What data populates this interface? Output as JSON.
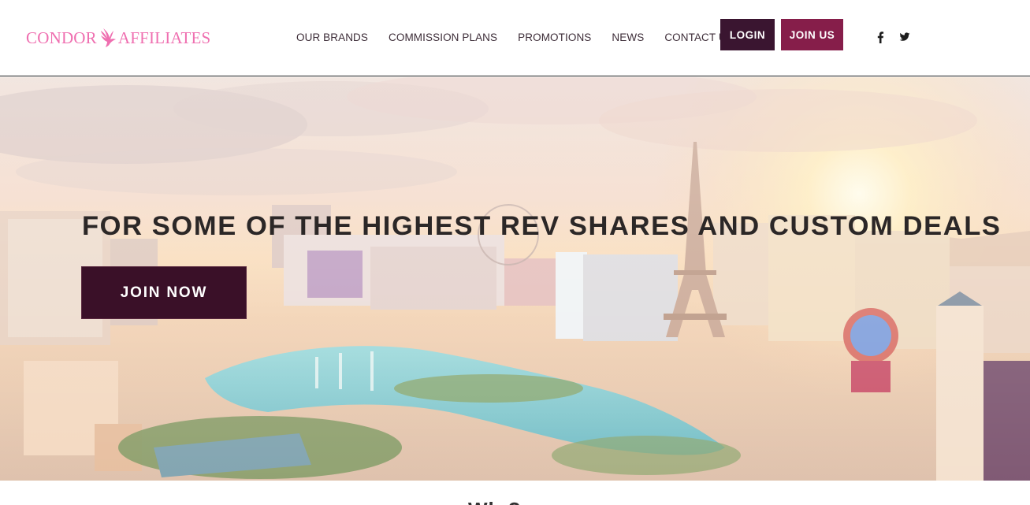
{
  "logo": {
    "left_text": "CONDOR",
    "right_text": "AFFILIATES",
    "icon": "condor-bird-icon",
    "color": "#ef6fb0"
  },
  "nav": {
    "items": [
      {
        "label": "OUR BRANDS"
      },
      {
        "label": "COMMISSION PLANS"
      },
      {
        "label": "PROMOTIONS"
      },
      {
        "label": "NEWS"
      },
      {
        "label": "CONTACT US"
      }
    ],
    "login_label": "LOGIN",
    "join_label": "JOIN US"
  },
  "social": {
    "icons": [
      "facebook-icon",
      "twitter-icon"
    ]
  },
  "hero": {
    "headline": "FOR SOME OF THE HIGHEST REV SHARES AND CUSTOM DEALS",
    "cta_label": "JOIN NOW",
    "background": "Las Vegas skyline at sunset"
  },
  "section": {
    "title_partial": "Wh      ?"
  },
  "colors": {
    "logo": "#ef6fb0",
    "login_bg": "#3a1530",
    "join_bg": "#861e4a",
    "cta_bg": "#3a1028",
    "headline_text": "#2b2727"
  }
}
